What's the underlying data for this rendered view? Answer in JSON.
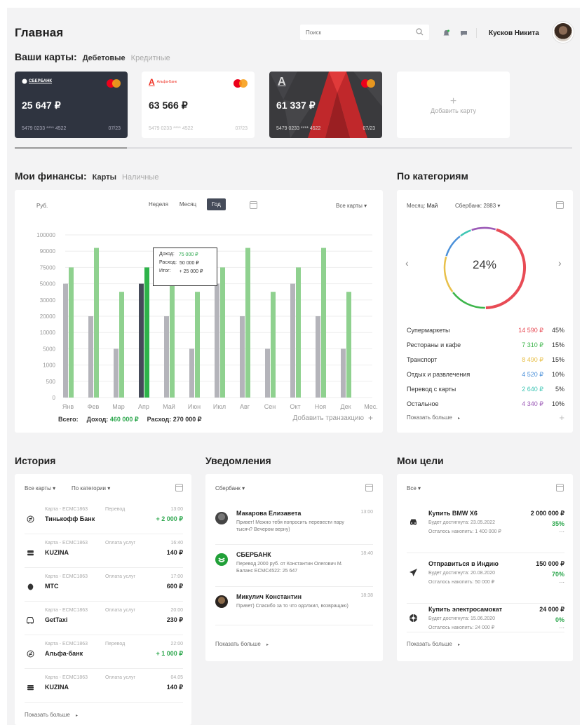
{
  "header": {
    "title": "Главная",
    "search_placeholder": "Поиск",
    "user_name": "Кусков Никита"
  },
  "cards_section": {
    "title": "Ваши карты:",
    "tab_debit": "Дебетовые",
    "tab_credit": "Кредитные",
    "cards": [
      {
        "bank": "СБЕРБАНК",
        "amount": "25 647 ₽",
        "number": "5479 0233 **** 4522",
        "expiry": "07/23"
      },
      {
        "bank": "Альфа-Банк",
        "amount": "63 566 ₽",
        "number": "5479 0233 **** 4522",
        "expiry": "07/23"
      },
      {
        "bank": "А",
        "amount": "61 337 ₽",
        "number": "5479 0233 **** 4522",
        "expiry": "07/23"
      }
    ],
    "add_card_plus": "+",
    "add_card_label": "Добавить карту"
  },
  "finances": {
    "title": "Мои финансы:",
    "tab_cards": "Карты",
    "tab_cash": "Наличные",
    "currency_label": "Руб.",
    "periods": [
      "Неделя",
      "Месяц",
      "Год"
    ],
    "active_period": "Год",
    "all_cards": "Все карты",
    "tooltip": {
      "income_label": "Доход:",
      "income_value": "75 000 ₽",
      "expense_label": "Расход:",
      "expense_value": "50 000 ₽",
      "total_label": "Итог:",
      "total_value": "+ 25 000 ₽"
    },
    "footer_total": "Всего:",
    "footer_income_label": "Доход:",
    "footer_income_value": "460 000 ₽",
    "footer_expense_label": "Расход:",
    "footer_expense_value": "270 000 ₽",
    "add_transaction": "Добавить транзакцию",
    "add_plus": "+"
  },
  "chart_data": {
    "type": "bar",
    "categories": [
      "Янв",
      "Фев",
      "Мар",
      "Апр",
      "Май",
      "Июн",
      "Июл",
      "Авг",
      "Сен",
      "Окт",
      "Ноя",
      "Дек",
      "Мес."
    ],
    "y_ticks": [
      "100000",
      "90000",
      "75000",
      "50000",
      "30000",
      "20000",
      "10000",
      "5000",
      "1000",
      "500",
      "0"
    ],
    "series": [
      {
        "name": "Расход",
        "values": [
          50000,
          20000,
          5000,
          50000,
          20000,
          5000,
          50000,
          20000,
          5000,
          50000,
          20000,
          5000,
          null
        ]
      },
      {
        "name": "Доход",
        "values": [
          75000,
          92000,
          40000,
          75000,
          92000,
          40000,
          75000,
          92000,
          40000,
          75000,
          92000,
          40000,
          null
        ]
      }
    ],
    "highlight_index": 3,
    "colors": {
      "expense": "#b4b4ba",
      "income": "#8fd18f",
      "expense_hl": "#454b59",
      "income_hl": "#2eb34a"
    }
  },
  "categories_panel": {
    "title": "По категориям",
    "month_label": "Месяц:",
    "month_value": "Май",
    "card_select": "Сбербанк: 2883",
    "donut_percent": "24%",
    "donut_segments": [
      {
        "color": "#e84b55",
        "value": 45
      },
      {
        "color": "#3cb54a",
        "value": 15
      },
      {
        "color": "#e8c04a",
        "value": 15
      },
      {
        "color": "#4a90d9",
        "value": 10
      },
      {
        "color": "#3fc6b5",
        "value": 5
      },
      {
        "color": "#9b59b6",
        "value": 10
      }
    ],
    "rows": [
      {
        "name": "Супермаркеты",
        "amount": "14 590 ₽",
        "percent": "45%",
        "color": "#e84b55"
      },
      {
        "name": "Рестораны и кафе",
        "amount": "7 310 ₽",
        "percent": "15%",
        "color": "#3cb54a"
      },
      {
        "name": "Транспорт",
        "amount": "8 490 ₽",
        "percent": "15%",
        "color": "#e8c04a"
      },
      {
        "name": "Отдых и развлечения",
        "amount": "4 520 ₽",
        "percent": "10%",
        "color": "#4a90d9"
      },
      {
        "name": "Перевод с карты",
        "amount": "2 640 ₽",
        "percent": "5%",
        "color": "#3fc6b5"
      },
      {
        "name": "Остальное",
        "amount": "4 340 ₽",
        "percent": "10%",
        "color": "#9b59b6"
      }
    ],
    "show_more": "Показать больше",
    "plus": "+"
  },
  "history": {
    "title": "История",
    "filter_cards": "Все карты",
    "filter_category": "По категории",
    "items": [
      {
        "card": "Карта - ЕСМС1863",
        "type": "Перевод",
        "time": "13:00",
        "name": "Тинькофф Банк",
        "amount": "+ 2 000 ₽",
        "positive": true,
        "icon": "transfer-icon"
      },
      {
        "card": "Карта - ЕСМС1863",
        "type": "Оплата услуг",
        "time": "16:40",
        "name": "KUZINA",
        "amount": "140 ₽",
        "positive": false,
        "icon": "burger-icon"
      },
      {
        "card": "Карта - ЕСМС1863",
        "type": "Оплата услуг",
        "time": "17:00",
        "name": "МТС",
        "amount": "600 ₽",
        "positive": false,
        "icon": "egg-icon"
      },
      {
        "card": "Карта - ЕСМС1863",
        "type": "Оплата услуг",
        "time": "20:00",
        "name": "GetTaxi",
        "amount": "230 ₽",
        "positive": false,
        "icon": "car-icon"
      },
      {
        "card": "Карта - ЕСМС1863",
        "type": "Перевод",
        "time": "22:00",
        "name": "Альфа-банк",
        "amount": "+ 1 000 ₽",
        "positive": true,
        "icon": "transfer-icon"
      },
      {
        "card": "Карта - ЕСМС1863",
        "type": "Оплата услуг",
        "time": "04.05",
        "name": "KUZINA",
        "amount": "140 ₽",
        "positive": false,
        "icon": "burger-icon"
      }
    ],
    "show_more": "Показать больше"
  },
  "notifications": {
    "title": "Уведомления",
    "filter_bank": "Сбербанк",
    "items": [
      {
        "name": "Макарова Елизавета",
        "time": "13:00",
        "text": "Привет! Можно тебя попросить перевести пару тысяч? Вечером верну)"
      },
      {
        "name": "СБЕРБАНК",
        "time": "18:40",
        "text": "Перевод 2000 руб. от Константин Олегович М. Баланс ЕСМС4522: 25 647"
      },
      {
        "name": "Микулич Константин",
        "time": "18:38",
        "text": "Привет) Спасибо за то что одолжил, возвращаю)"
      }
    ],
    "show_more": "Показать больше"
  },
  "goals": {
    "title": "Мои цели",
    "filter_all": "Все",
    "items": [
      {
        "name": "Купить BMW X6",
        "amount": "2 000 000 ₽",
        "date": "Будет достигнута: 23.05.2022",
        "remaining": "Осталось накопить: 1 400 000 ₽",
        "percent": "35%"
      },
      {
        "name": "Отправиться в Индию",
        "amount": "150 000 ₽",
        "date": "Будет достигнута: 20.08.2020",
        "remaining": "Осталось накопить: 50 000 ₽",
        "percent": "70%"
      },
      {
        "name": "Купить электросамокат",
        "amount": "24 000 ₽",
        "date": "Будет достигнута: 15.06.2020",
        "remaining": "Осталось накопить: 24 000 ₽",
        "percent": "0%"
      }
    ],
    "dots": "...",
    "show_more": "Показать больше"
  }
}
